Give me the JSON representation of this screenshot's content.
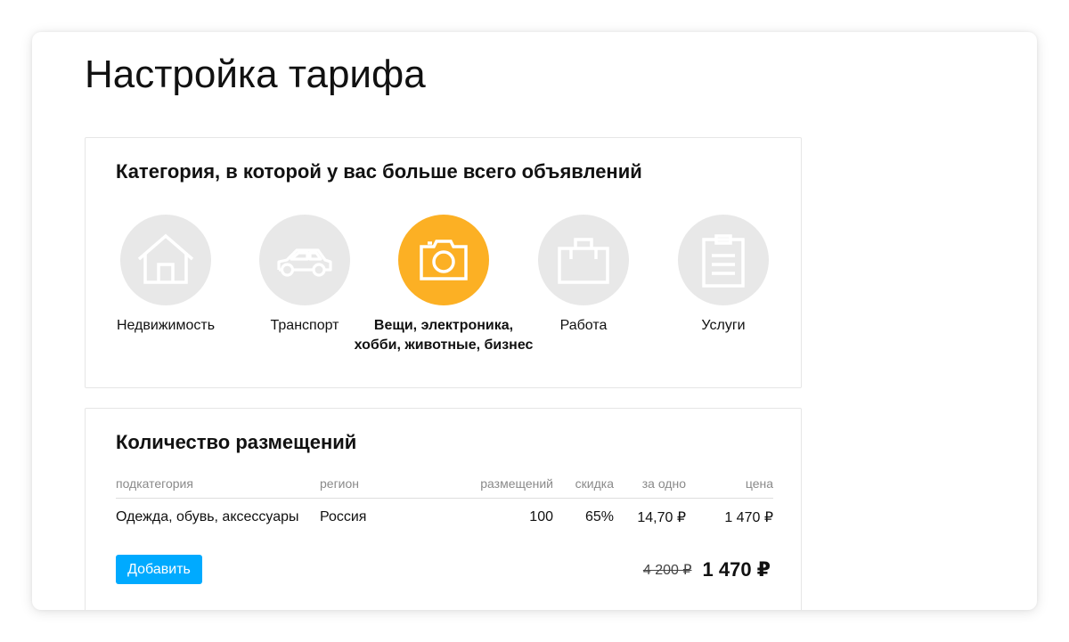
{
  "page": {
    "title": "Настройка тарифа"
  },
  "categories": {
    "heading": "Категория, в которой у вас больше всего объявлений",
    "items": [
      {
        "label": "Недвижимость",
        "icon": "house-icon",
        "selected": false
      },
      {
        "label": "Транспорт",
        "icon": "car-icon",
        "selected": false
      },
      {
        "label": "Вещи, электроника, хобби, животные, бизнес",
        "icon": "camera-icon",
        "selected": true
      },
      {
        "label": "Работа",
        "icon": "briefcase-icon",
        "selected": false
      },
      {
        "label": "Услуги",
        "icon": "clipboard-icon",
        "selected": false
      }
    ]
  },
  "placements": {
    "heading": "Количество размещений",
    "columns": {
      "subcategory": "подкатегория",
      "region": "регион",
      "count": "размещений",
      "discount": "скидка",
      "per_item": "за одно",
      "price": "цена"
    },
    "rows": [
      {
        "subcategory": "Одежда, обувь, аксессуары",
        "region": "Россия",
        "count": "100",
        "discount": "65%",
        "per_item": "14,70 ₽",
        "price": "1 470 ₽"
      }
    ],
    "add_label": "Добавить",
    "old_total": "4 200 ₽",
    "new_total": "1 470 ₽"
  },
  "colors": {
    "accent": "#fcb024",
    "button": "#00aaff",
    "inactive_circle": "#e8e8e8"
  }
}
